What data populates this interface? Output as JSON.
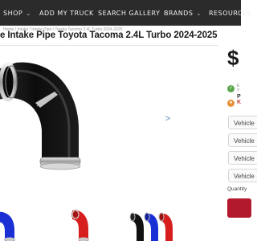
{
  "nav": {
    "items": [
      {
        "label": "SHOP",
        "has_dropdown": true
      },
      {
        "label": "ADD MY TRUCK",
        "has_dropdown": false
      },
      {
        "label": "SEARCH GALLERY",
        "has_dropdown": false
      },
      {
        "label": "BRANDS",
        "has_dropdown": true
      },
      {
        "label": "RESOURCES",
        "has_dropdown": false
      }
    ]
  },
  "breadcrumb": "Home / Intake / Intake Pipe / Toyota Tacoma 2.4L Turbo 2024-2025",
  "product": {
    "title": "e Intake Pipe Toyota Tacoma 2.4L Turbo 2024-2025",
    "price_fragment": "$",
    "stock_line_1": "E",
    "stock_line_2": "Y",
    "pickup_fragment": "P",
    "shipping_fragment": "K",
    "next_image_label": ">",
    "image_colors": {
      "main": "#111111",
      "thumb_blue": "#1a2fd4",
      "thumb_red": "#d61e1e"
    }
  },
  "options": {
    "buttons": [
      {
        "label": "Vehicle"
      },
      {
        "label": "Vehicle"
      },
      {
        "label": "Vehicle"
      },
      {
        "label": "Vehicle"
      }
    ],
    "quantity_label": "Quantity"
  },
  "colors": {
    "nav_bg": "#2b2b2b",
    "accent_red": "#b3192d",
    "badge_green": "#5aa74a",
    "badge_orange": "#e8913a"
  }
}
